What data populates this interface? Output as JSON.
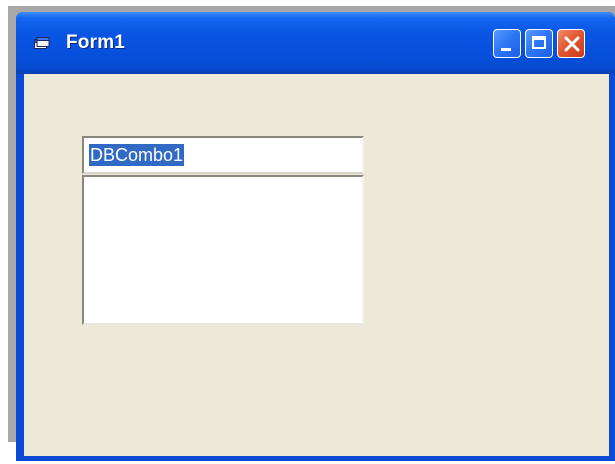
{
  "window": {
    "title": "Form1",
    "icons": {
      "app": "form-icon",
      "minimize": "minimize-icon",
      "maximize": "maximize-icon",
      "close": "close-icon"
    },
    "colors": {
      "titlebar": "#0a55e4",
      "client": "#ece9d8",
      "selection": "#316ac5",
      "close_button": "#e2542e"
    }
  },
  "form": {
    "dbcombo": {
      "value": "DBCombo1",
      "list_items": []
    }
  }
}
